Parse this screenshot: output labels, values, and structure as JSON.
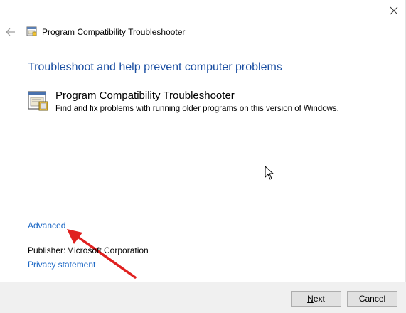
{
  "window": {
    "close_glyph": "✕"
  },
  "header": {
    "back_glyph": "←",
    "title": "Program Compatibility Troubleshooter",
    "icon": "troubleshooter-icon"
  },
  "main": {
    "heading": "Troubleshoot and help prevent computer problems",
    "item": {
      "icon": "troubleshooter-icon",
      "title": "Program Compatibility Troubleshooter",
      "description": "Find and fix problems with running older programs on this version of Windows."
    }
  },
  "links": {
    "advanced": "Advanced",
    "privacy": "Privacy statement"
  },
  "publisher": {
    "label": "Publisher:",
    "value": "Microsoft Corporation"
  },
  "footer": {
    "next_label_mnemonic": "N",
    "next_label_rest": "ext",
    "cancel_label": "Cancel"
  },
  "colors": {
    "heading": "#1a4ea1",
    "link": "#1a66c4",
    "annotation_arrow": "#e0201f",
    "footer_bg": "#f0f0f0"
  }
}
